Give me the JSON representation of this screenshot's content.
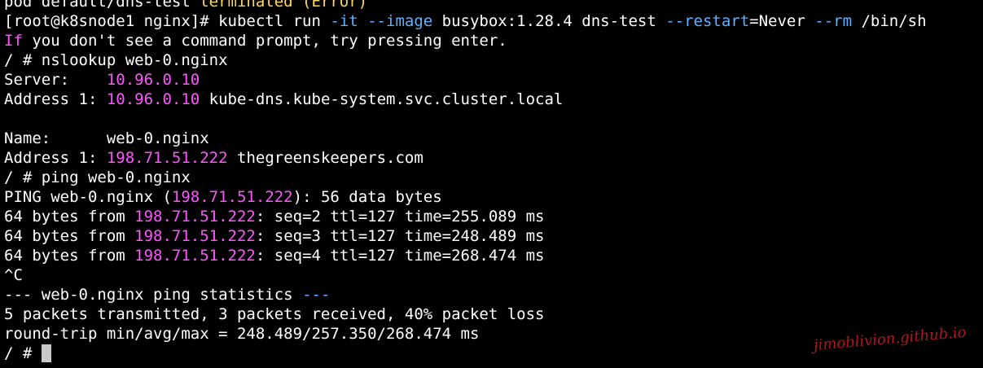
{
  "terminal": {
    "line0": {
      "text_a": "pod default/dns-test ",
      "text_b": "terminated",
      "text_c": " (Error)"
    },
    "line1": {
      "prompt": "[root@k8snode1 nginx]# kubectl run ",
      "flag_it": "-it",
      "flag_image": "--image",
      "arg_image": " busybox:1.28.4 dns-test ",
      "flag_restart": "--restart",
      "arg_restart": "=Never ",
      "flag_rm": "--rm",
      "arg_shell": " /bin/sh"
    },
    "line2": {
      "keyword": "If",
      "rest": " you don't see a command prompt, try pressing enter."
    },
    "line3": "/ # nslookup web-0.nginx",
    "line4": {
      "label": "Server:    ",
      "value": "10.96.0.10"
    },
    "line5": {
      "label": "Address 1: ",
      "value": "10.96.0.10",
      "suffix": " kube-dns.kube-system.svc.cluster.local"
    },
    "line6": "",
    "line7": {
      "label": "Name:      ",
      "value": "web-0.nginx"
    },
    "line8": {
      "label": "Address 1: ",
      "value": "198.71.51.222",
      "suffix": " thegreenskeepers.com"
    },
    "line9": "/ # ping web-0.nginx",
    "line10": {
      "prefix": "PING web-0.nginx (",
      "ip": "198.71.51.222",
      "suffix": "): 56 data bytes"
    },
    "ping_replies": [
      {
        "prefix": "64 bytes from ",
        "ip": "198.71.51.222",
        "suffix": ": seq=2 ttl=127 time=255.089 ms"
      },
      {
        "prefix": "64 bytes from ",
        "ip": "198.71.51.222",
        "suffix": ": seq=3 ttl=127 time=248.489 ms"
      },
      {
        "prefix": "64 bytes from ",
        "ip": "198.71.51.222",
        "suffix": ": seq=4 ttl=127 time=268.474 ms"
      }
    ],
    "line14": "^C",
    "line15": {
      "dash_start": "---",
      "text": " web-0.nginx ping statistics ",
      "dash_end": "---"
    },
    "line16": "5 packets transmitted, 3 packets received, 40% packet loss",
    "line17": "round-trip min/avg/max = 248.489/257.350/268.474 ms",
    "line18": "/ # "
  },
  "watermark": "jimoblivion.github.io",
  "colors": {
    "background": "#000000",
    "foreground": "#ffffff",
    "highlight_magenta": "#ff55ff",
    "flag_blue": "#5fb0ff",
    "watermark_red": "#b0181c"
  }
}
